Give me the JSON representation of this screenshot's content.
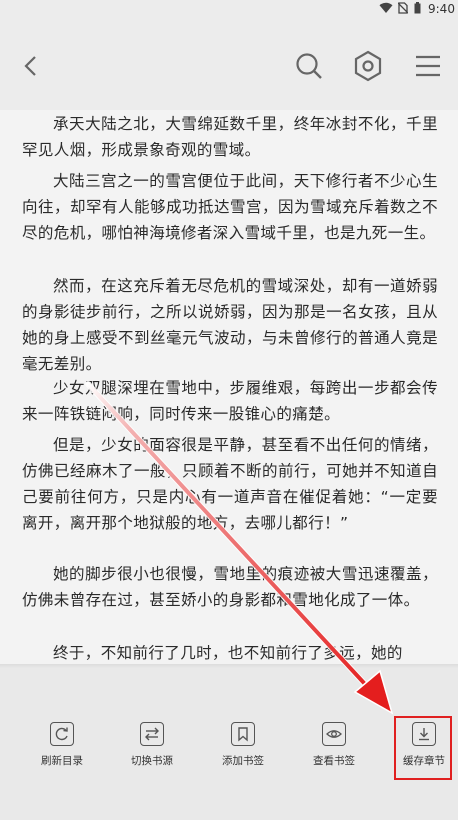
{
  "status_bar": {
    "time": "9:40"
  },
  "reader": {
    "paragraphs": [
      "承天大陆之北，大雪绵延数千里，终年冰封不化，千里罕见人烟，形成景象奇观的雪域。",
      "大陆三宫之一的雪宫便位于此间，天下修行者不少心生向往，却罕有人能够成功抵达雪宫，因为雪域充斥着数之不尽的危机，哪怕神海境修者深入雪域千里，也是九死一生。",
      "然而，在这充斥着无尽危机的雪域深处，却有一道娇弱的身影徒步前行，之所以说娇弱，因为那是一名女孩，且从她的身上感受不到丝毫元气波动，与未曾修行的普通人竟是毫无差别。",
      "少女双腿深埋在雪地中，步履维艰，每跨出一步都会传来一阵铁链闷响，同时传来一股锥心的痛楚。",
      "但是，少女的面容很是平静，甚至看不出任何的情绪，仿佛已经麻木了一般，只顾着不断的前行，可她并不知道自己要前往何方，只是内心有一道声音在催促着她：“一定要离开，离开那个地狱般的地方，去哪儿都行！”",
      "她的脚步很小也很慢，雪地里的痕迹被大雪迅速覆盖，仿佛未曾存在过，甚至娇小的身影都和雪地化成了一体。",
      "终于，不知前行了几时，也不知前行了多远，她的"
    ]
  },
  "toolbar": {
    "items": [
      {
        "label": "刷新目录",
        "icon": "refresh-icon"
      },
      {
        "label": "切换书源",
        "icon": "swap-icon"
      },
      {
        "label": "添加书签",
        "icon": "bookmark-icon"
      },
      {
        "label": "查看书签",
        "icon": "eye-icon"
      },
      {
        "label": "缓存章节",
        "icon": "download-icon"
      }
    ]
  },
  "colors": {
    "highlight": "#e02020",
    "icon": "#555555",
    "background": "#f3f3f3"
  }
}
